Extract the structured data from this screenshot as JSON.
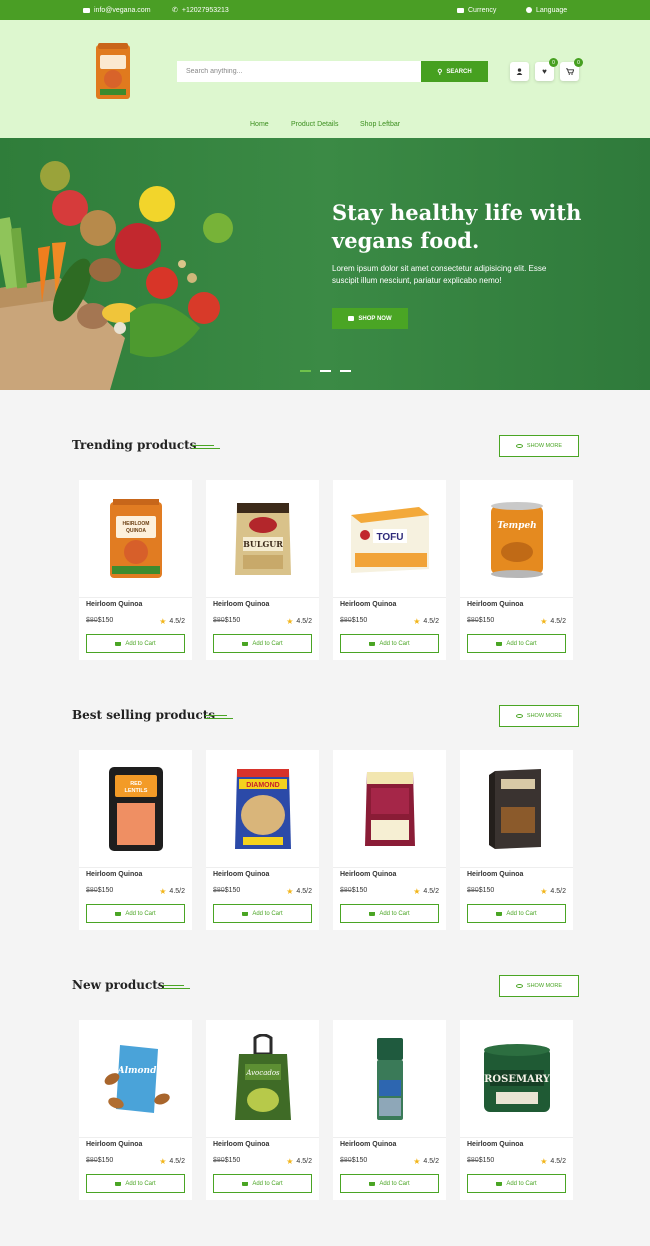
{
  "topbar": {
    "email": "info@vegana.com",
    "phone": "+12027953213",
    "currency": "Currency",
    "language": "Language"
  },
  "header": {
    "search_placeholder": "Search anything...",
    "search_label": "SEARCH",
    "wishlist_count": "0",
    "cart_count": "0",
    "nav": [
      "Home",
      "Product Details",
      "Shop Leftbar"
    ]
  },
  "hero": {
    "title_line1": "Stay healthy life with",
    "title_line2": "vegans food.",
    "text": "Lorem ipsum dolor sit amet consectetur adipisicing elit. Esse suscipit illum nesciunt, pariatur explicabo nemo!",
    "button": "SHOP NOW"
  },
  "sections": [
    {
      "title": "Trending products",
      "show_more": "SHOW MORE",
      "products": [
        {
          "name": "Heirloom Quinoa",
          "old_price": "$80",
          "price": "$150",
          "rating": "4.5/2",
          "add": "Add to Cart",
          "pack": "HEIRLOOM QUINOA"
        },
        {
          "name": "Heirloom Quinoa",
          "old_price": "$80",
          "price": "$150",
          "rating": "4.5/2",
          "add": "Add to Cart",
          "pack": "BULGUR"
        },
        {
          "name": "Heirloom Quinoa",
          "old_price": "$80",
          "price": "$150",
          "rating": "4.5/2",
          "add": "Add to Cart",
          "pack": "TOFU"
        },
        {
          "name": "Heirloom Quinoa",
          "old_price": "$80",
          "price": "$150",
          "rating": "4.5/2",
          "add": "Add to Cart",
          "pack": "Tempeh"
        }
      ]
    },
    {
      "title": "Best selling products",
      "show_more": "SHOW MORE",
      "products": [
        {
          "name": "Heirloom Quinoa",
          "old_price": "$80",
          "price": "$150",
          "rating": "4.5/2",
          "add": "Add to Cart",
          "pack": "RED LENTILS"
        },
        {
          "name": "Heirloom Quinoa",
          "old_price": "$80",
          "price": "$150",
          "rating": "4.5/2",
          "add": "Add to Cart",
          "pack": "DIAMOND"
        },
        {
          "name": "Heirloom Quinoa",
          "old_price": "$80",
          "price": "$150",
          "rating": "4.5/2",
          "add": "Add to Cart",
          "pack": ""
        },
        {
          "name": "Heirloom Quinoa",
          "old_price": "$80",
          "price": "$150",
          "rating": "4.5/2",
          "add": "Add to Cart",
          "pack": ""
        }
      ]
    },
    {
      "title": "New products",
      "show_more": "SHOW MORE",
      "products": [
        {
          "name": "Heirloom Quinoa",
          "old_price": "$80",
          "price": "$150",
          "rating": "4.5/2",
          "add": "Add to Cart",
          "pack": "Almond"
        },
        {
          "name": "Heirloom Quinoa",
          "old_price": "$80",
          "price": "$150",
          "rating": "4.5/2",
          "add": "Add to Cart",
          "pack": "Avocados"
        },
        {
          "name": "Heirloom Quinoa",
          "old_price": "$80",
          "price": "$150",
          "rating": "4.5/2",
          "add": "Add to Cart",
          "pack": ""
        },
        {
          "name": "Heirloom Quinoa",
          "old_price": "$80",
          "price": "$150",
          "rating": "4.5/2",
          "add": "Add to Cart",
          "pack": "ROSEMARY"
        }
      ]
    }
  ],
  "colors": {
    "brand_green": "#4aa524",
    "topbar": "#4a9e25",
    "header_bg": "#ddf7cf",
    "hero_bg": "#2f7d3a",
    "star": "#f2b51a"
  }
}
